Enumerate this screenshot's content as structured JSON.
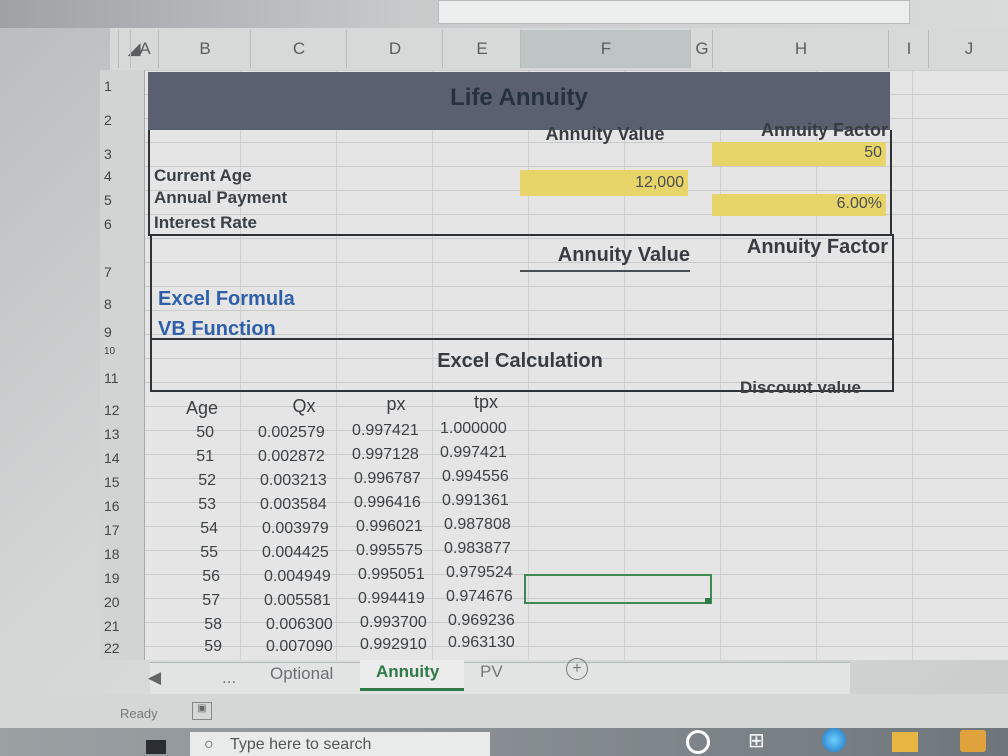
{
  "columns": [
    "A",
    "B",
    "C",
    "D",
    "E",
    "F",
    "G",
    "H",
    "I",
    "J"
  ],
  "rows": [
    "1",
    "2",
    "3",
    "4",
    "5",
    "6",
    "7",
    "8",
    "9",
    "10",
    "11",
    "12",
    "13",
    "14",
    "15",
    "16",
    "17",
    "18",
    "19",
    "20",
    "21",
    "22"
  ],
  "title": "Life Annuity",
  "inputs": {
    "annuity_value_hdr": "Annuity Value",
    "annuity_factor_hdr": "Annuity Factor",
    "factor_val": "50",
    "annual_payment_val": "12,000",
    "interest_rate_val": "6.00%",
    "current_age": "Current Age",
    "annual_payment": "Annual Payment",
    "interest_rate": "Interest Rate"
  },
  "results": {
    "annuity_value_hdr": "Annuity Value",
    "annuity_factor_hdr": "Annuity Factor",
    "excel_formula": "Excel Formula",
    "vb_function": "VB Function"
  },
  "calc": {
    "title": "Excel Calculation",
    "discount_value": "Discount value",
    "headers": [
      "Age",
      "Qx",
      "px",
      "tpx"
    ],
    "rows": [
      [
        "50",
        "0.002579",
        "0.997421",
        "1.000000"
      ],
      [
        "51",
        "0.002872",
        "0.997128",
        "0.997421"
      ],
      [
        "52",
        "0.003213",
        "0.996787",
        "0.994556"
      ],
      [
        "53",
        "0.003584",
        "0.996416",
        "0.991361"
      ],
      [
        "54",
        "0.003979",
        "0.996021",
        "0.987808"
      ],
      [
        "55",
        "0.004425",
        "0.995575",
        "0.983877"
      ],
      [
        "56",
        "0.004949",
        "0.995051",
        "0.979524"
      ],
      [
        "57",
        "0.005581",
        "0.994419",
        "0.974676"
      ],
      [
        "58",
        "0.006300",
        "0.993700",
        "0.969236"
      ],
      [
        "59",
        "0.007090",
        "0.992910",
        "0.963130"
      ]
    ]
  },
  "tabs": {
    "more": "...",
    "optional": "Optional",
    "annuity": "Annuity",
    "pv": "PV",
    "add": "+"
  },
  "status": {
    "ready": "Ready"
  },
  "taskbar": {
    "search_placeholder": "Type here to search"
  }
}
